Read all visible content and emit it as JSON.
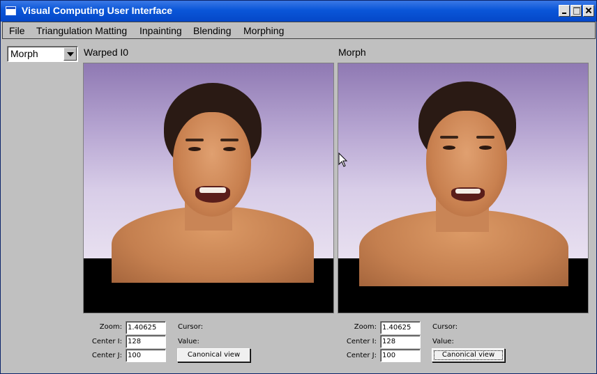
{
  "window": {
    "title": "Visual Computing User Interface",
    "title_bar_color": "#0a56d8"
  },
  "menubar": {
    "items": [
      "File",
      "Triangulation Matting",
      "Inpainting",
      "Blending",
      "Morphing"
    ]
  },
  "sidebar": {
    "mode_select": {
      "value": "Morph"
    }
  },
  "panels": [
    {
      "label": "Warped I0",
      "zoom_label": "Zoom:",
      "zoom_value": "1.40625",
      "center_i_label": "Center I:",
      "center_i_value": "128",
      "center_j_label": "Center J:",
      "center_j_value": "100",
      "cursor_label": "Cursor:",
      "value_label": "Value:",
      "canonical_button": "Canonical view"
    },
    {
      "label": "Morph",
      "zoom_label": "Zoom:",
      "zoom_value": "1.40625",
      "center_i_label": "Center I:",
      "center_i_value": "128",
      "center_j_label": "Center J:",
      "center_j_value": "100",
      "cursor_label": "Cursor:",
      "value_label": "Value:",
      "canonical_button": "Canonical view"
    }
  ],
  "icons": {
    "app": "window-app-icon",
    "minimize": "minimize-icon",
    "maximize": "maximize-icon",
    "close": "close-icon",
    "dropdown": "chevron-down-icon",
    "pointer": "mouse-pointer-icon"
  }
}
